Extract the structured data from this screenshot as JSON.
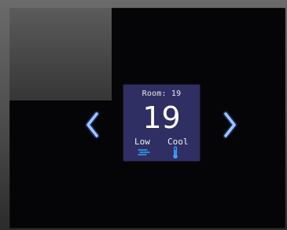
{
  "thermostat": {
    "room_label": "Room: 19",
    "set_temperature": "19",
    "fan_speed": "Low",
    "mode": "Cool"
  },
  "icons": {
    "previous": "chevron-left-icon",
    "next": "chevron-right-icon",
    "fan": "fan-speed-icon",
    "mode": "thermometer-icon"
  },
  "colors": {
    "card_background": "#2f2f63",
    "arrow_glow": "#3c7dff",
    "icon_accent": "#3aa0ff",
    "screen_background": "#050507"
  }
}
